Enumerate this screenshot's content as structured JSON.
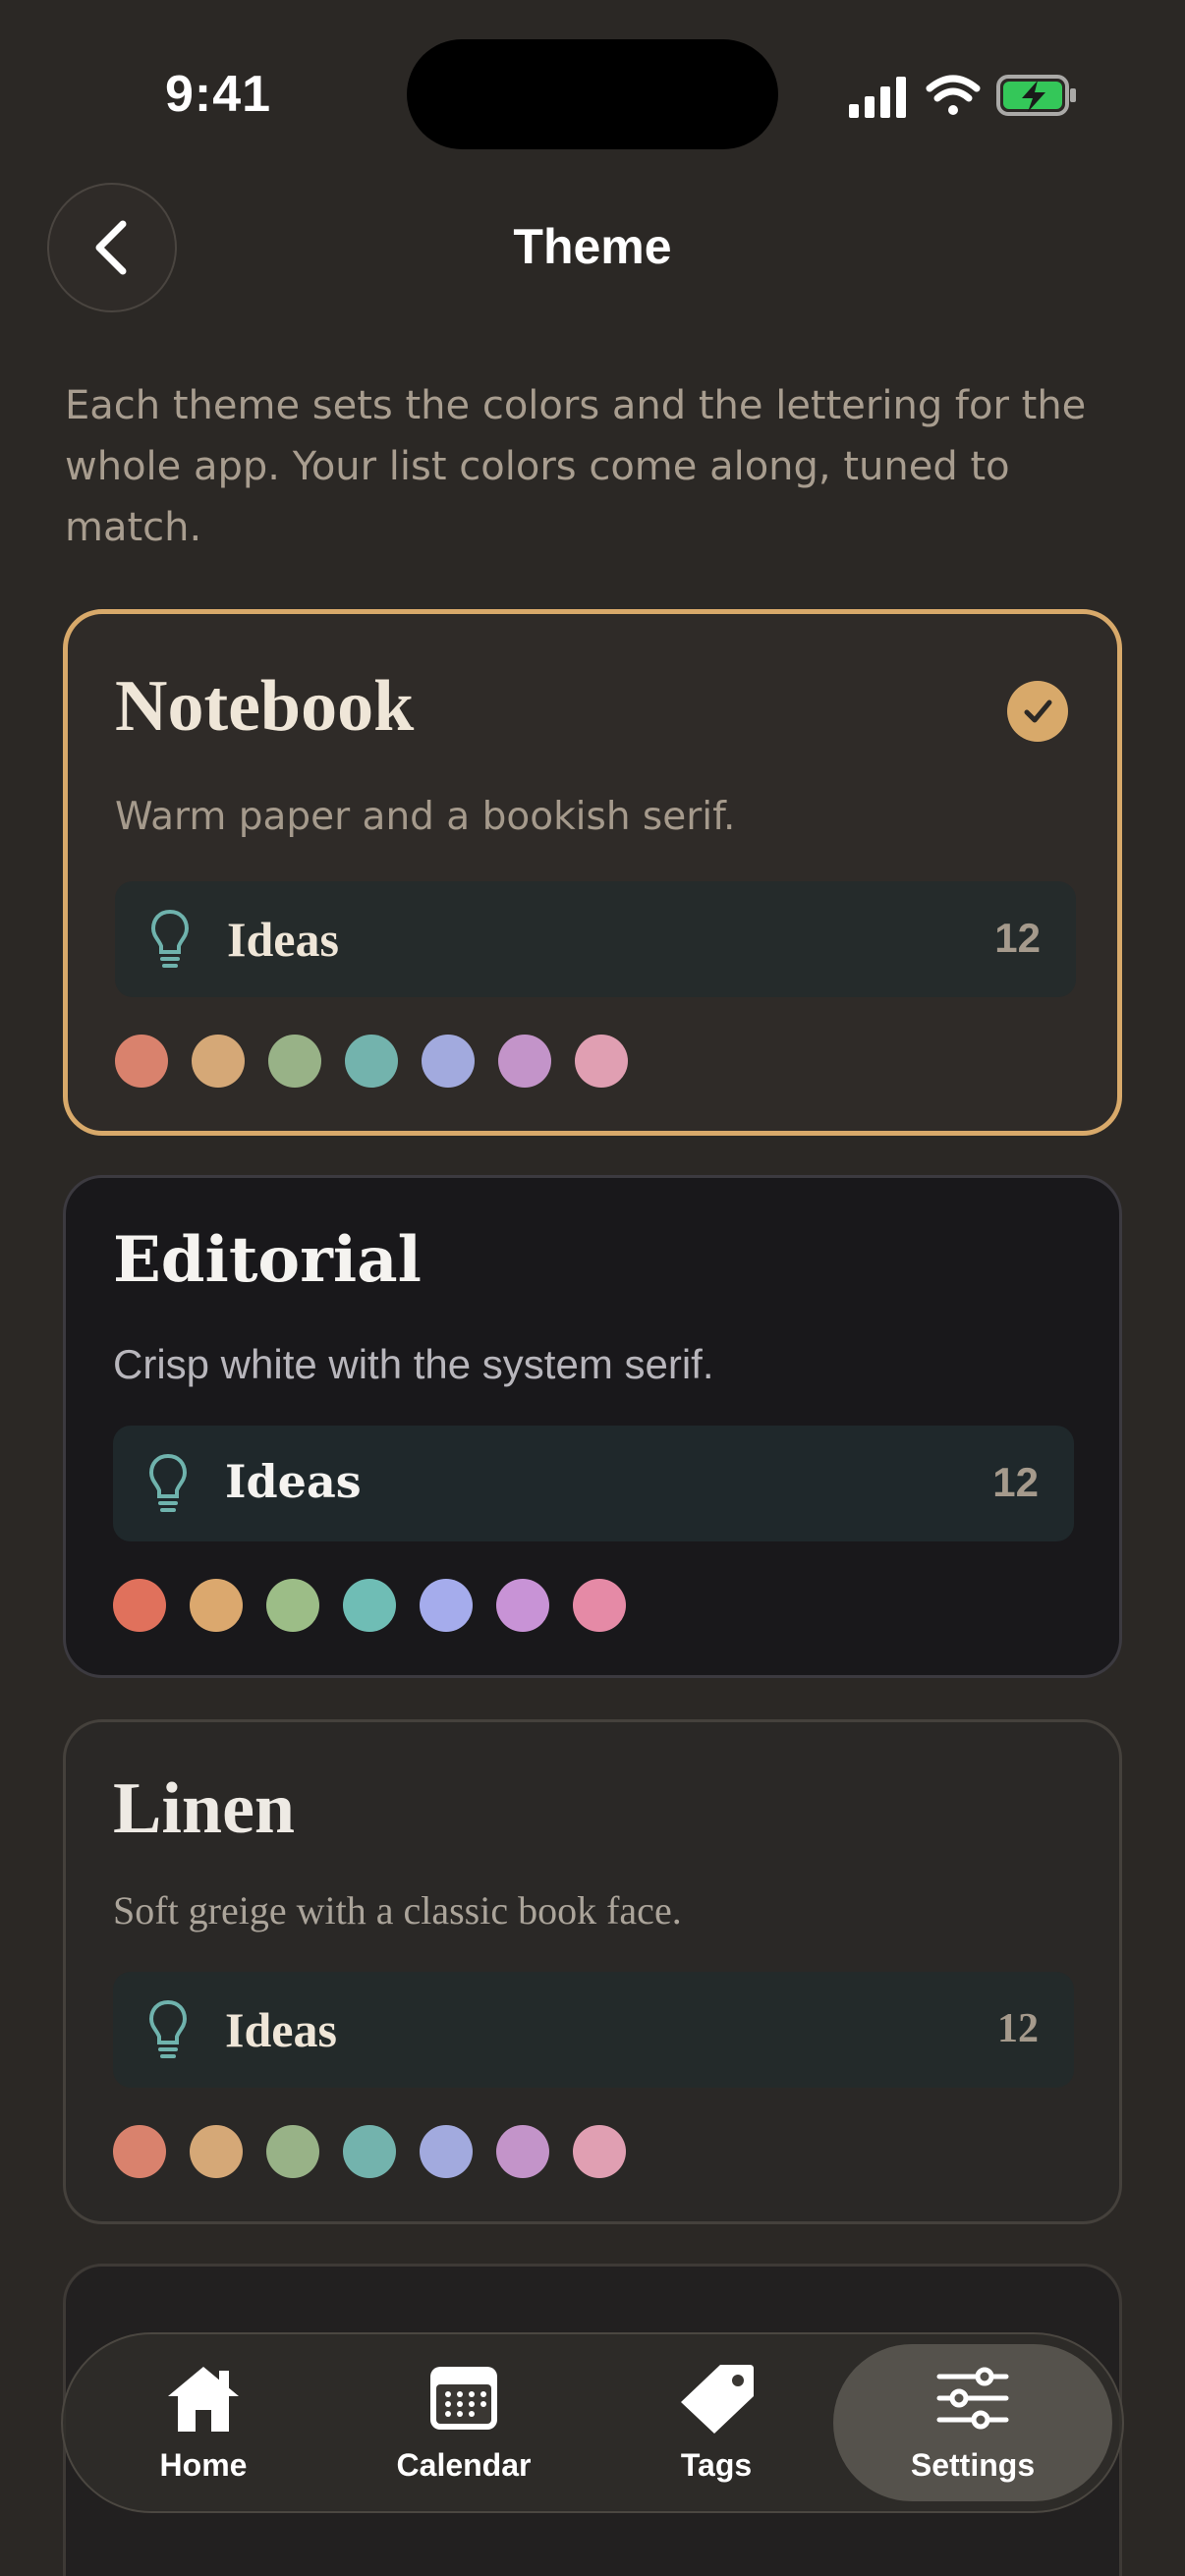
{
  "status_bar": {
    "time": "9:41"
  },
  "nav": {
    "title": "Theme"
  },
  "intro": "Each theme sets the colors and the lettering for the whole app. Your list colors come along, tuned to match.",
  "themes": [
    {
      "name": "Notebook",
      "description": "Warm paper and a bookish serif.",
      "selected": true,
      "preview_label": "Ideas",
      "preview_count": "12",
      "swatches": [
        "#d9826d",
        "#d5a877",
        "#98b287",
        "#73b3ad",
        "#a2aade",
        "#c394c9",
        "#e09fb2"
      ]
    },
    {
      "name": "Editorial",
      "description": "Crisp white with the system serif.",
      "selected": false,
      "preview_label": "Ideas",
      "preview_count": "12",
      "swatches": [
        "#e0715c",
        "#dba86e",
        "#9cbd87",
        "#6fbdb5",
        "#a5acec",
        "#c893d6",
        "#e58aa6"
      ]
    },
    {
      "name": "Linen",
      "description": "Soft greige with a classic book face.",
      "selected": false,
      "preview_label": "Ideas",
      "preview_count": "12",
      "swatches": [
        "#d9826d",
        "#d5a877",
        "#98b287",
        "#73b3ad",
        "#a2aade",
        "#c394c9",
        "#e09fb2"
      ]
    }
  ],
  "colors": {
    "accent": "#d8a96a",
    "background": "#2b2825",
    "row_icon": "#6fb3ad"
  },
  "tab_bar": {
    "items": [
      {
        "label": "Home",
        "icon": "house-icon"
      },
      {
        "label": "Calendar",
        "icon": "calendar-icon"
      },
      {
        "label": "Tags",
        "icon": "tag-icon"
      },
      {
        "label": "Settings",
        "icon": "sliders-icon",
        "active": true
      }
    ]
  }
}
